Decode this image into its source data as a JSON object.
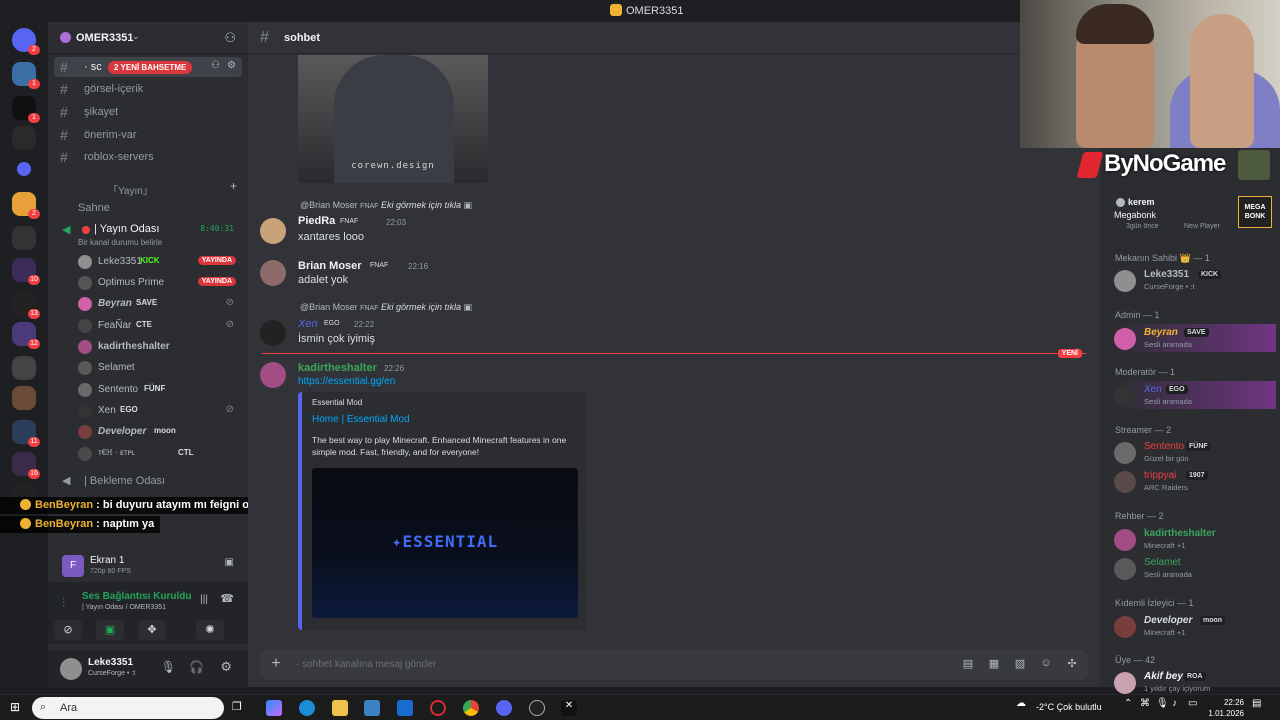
{
  "window": {
    "title": "OMER3351"
  },
  "guild": {
    "name": "OMER3351",
    "new_messages_pill": "2 YENİ BAHSETME"
  },
  "channels": [
    {
      "name": "sohbet",
      "prefix": "· sc"
    },
    {
      "name": "görsel-içerik"
    },
    {
      "name": "şikayet"
    },
    {
      "name": "önerim-var"
    },
    {
      "name": "roblox-servers"
    }
  ],
  "voice_category": "「Yayın」",
  "stage": "Sahne",
  "voice_channel": {
    "name": "| Yayın Odası",
    "status": "Bir kanal durumu belirle",
    "timer": "8:40:31",
    "members": [
      {
        "name": "Leke3351",
        "tag": "KICK",
        "live": "YAYINDA",
        "color": "#8f8f8f"
      },
      {
        "name": "Optimus Prime",
        "tag": "",
        "live": "YAYINDA",
        "color": "#555"
      },
      {
        "name": "Beyran",
        "tag": "SAVE",
        "live": "",
        "color": "#d05fa8"
      },
      {
        "name": "FeaÑar",
        "tag": "CTE",
        "live": "",
        "color": "#444"
      },
      {
        "name": "kadirtheshalter",
        "tag": "",
        "live": "",
        "color": "#a14c83"
      },
      {
        "name": "Selamet",
        "tag": "",
        "live": "",
        "color": "#5a5a5a"
      },
      {
        "name": "Sentento",
        "tag": "FÜNF",
        "live": "",
        "color": "#6a6a6a"
      },
      {
        "name": "Xen",
        "tag": "EGO",
        "live": "",
        "color": "#333"
      },
      {
        "name": "Developer",
        "tag": "moon",
        "live": "",
        "color": "#7a3d3d"
      },
      {
        "name": "ᴛ€ℍ · ᴇᴛᴘʟ",
        "tag": "CTL",
        "live": "",
        "color": "#4a4a4a"
      }
    ]
  },
  "waiting_room": "| Bekleme Odası",
  "stream_panel": {
    "name": "Ekran 1",
    "quality": "720p 60 FPS",
    "badge": "F"
  },
  "voice_status": {
    "title": "Ses Bağlantısı Kuruldu",
    "sub": "| Yayın Odası / OMER3351"
  },
  "user": {
    "name": "Leke3351",
    "activity": "CurseForge • :t"
  },
  "chat": {
    "channel_name": "sohbet",
    "image_caption": "corewn.design",
    "messages": [
      {
        "reply_to": "@Brian Moser",
        "reply_tag": "FNAF",
        "reply_text": "Eki görmek için tıkla",
        "author": "PiedRa",
        "author_color": "#f2f3f5",
        "tag": "FNAF",
        "time": "22:03",
        "text": "xantares looo"
      },
      {
        "author": "Brian Moser",
        "author_color": "#f2f3f5",
        "tag": "FNAF",
        "time": "22:16",
        "text": "adalet yok"
      },
      {
        "reply_to": "@Brian Moser",
        "reply_tag": "FNAF",
        "reply_text": "Eki görmek için tıkla",
        "author": "Xen",
        "author_color": "#5865f2",
        "tag": "EGO",
        "time": "22:22",
        "text": "İsmin çok iyimiş"
      },
      {
        "author": "kadirtheshalter",
        "author_color": "#3ba55d",
        "tag": "",
        "time": "22:26",
        "text": "https://essential.gg/en"
      }
    ],
    "new_label": "YENİ",
    "embed": {
      "provider": "Essential Mod",
      "title": "Home | Essential Mod",
      "description": "The best way to play Minecraft. Enhanced Minecraft features in one simple mod. Fast, friendly, and for everyone!",
      "image_text": "✦ESSENTIAL"
    },
    "composer_placeholder": "· sohbet kanalına mesaj gönder"
  },
  "overlay_chat": [
    {
      "user": "BenBeyran",
      "text": ": bi duyuru atayım mı feigni oynarsak kim gelir diye"
    },
    {
      "user": "BenBeyran",
      "text": ": naptım ya"
    }
  ],
  "members_panel": {
    "top_entry": {
      "name": "kerem",
      "activity": "Megabonk",
      "status": "3gün önce",
      "extra": "New Player",
      "badge": "MEGA BONK"
    },
    "groups": [
      {
        "title": "Mekanın Sahibi 👑 — 1",
        "members": [
          {
            "name": "Leke3351",
            "tag": "KICK",
            "status": "CurseForge • :t",
            "color": "#b5bac1"
          }
        ]
      },
      {
        "title": "Admin — 1",
        "members": [
          {
            "name": "Beyran",
            "tag": "SAVE",
            "status": "Sesli aramada",
            "color": "#f0b232"
          }
        ]
      },
      {
        "title": "Moderatör — 1",
        "members": [
          {
            "name": "Xen",
            "tag": "EGO",
            "status": "Sesli aramada",
            "color": "#5865f2"
          }
        ]
      },
      {
        "title": "Streamer — 2",
        "members": [
          {
            "name": "Sentento",
            "tag": "FÜNF",
            "status": "Güzel bir gün",
            "color": "#f23f43"
          },
          {
            "name": "trippyai",
            "tag": "1907",
            "status": "ARC Raiders",
            "color": "#f23f43"
          }
        ]
      },
      {
        "title": "Rehber — 2",
        "members": [
          {
            "name": "kadirtheshalter",
            "tag": "",
            "status": "Minecraft +1",
            "color": "#3ba55d"
          },
          {
            "name": "Selamet",
            "tag": "",
            "status": "Sesli aramada",
            "color": "#3ba55d"
          }
        ]
      },
      {
        "title": "Kıdemli İzleyici — 1",
        "members": [
          {
            "name": "Developer",
            "tag": "moon",
            "status": "Minecraft +1",
            "color": "#dbdee1"
          }
        ]
      },
      {
        "title": "Üye — 42",
        "members": [
          {
            "name": "Akif bey",
            "tag": "ROA",
            "status": "1 yıldır çay içiyorum",
            "color": "#f2f3f5"
          }
        ]
      }
    ]
  },
  "brand": {
    "text": "ByNoGame"
  },
  "taskbar": {
    "search_label": "Ara",
    "weather": "-2°C  Çok bulutlu",
    "time": "22:26",
    "date": "1.01.2026"
  },
  "colors": {
    "accent": "#5865f2",
    "danger": "#f23f43",
    "online": "#23a55a"
  }
}
